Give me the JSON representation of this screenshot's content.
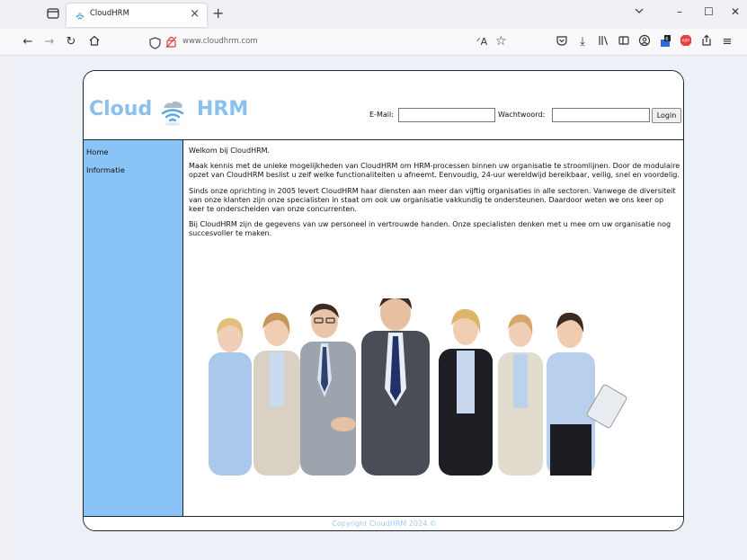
{
  "browser": {
    "tab_title": "CloudHRM",
    "tab_close": "×",
    "new_tab": "+",
    "url": "www.cloudhrm.com",
    "window_controls": {
      "minimize": "–",
      "maximize": "☐",
      "close": "✕"
    },
    "icons": [
      "tab-list-icon",
      "back-icon",
      "forward-icon",
      "reload-icon",
      "home-icon",
      "shield-icon",
      "lock-icon",
      "translate-icon",
      "bookmark-star-icon",
      "pocket-icon",
      "download-icon",
      "library-icon",
      "sidebar-icon",
      "account-icon",
      "extension-icon",
      "adblock-icon",
      "share-icon",
      "menu-icon"
    ]
  },
  "site": {
    "logo": {
      "word1": "Cloud",
      "word2": "HRM"
    },
    "login": {
      "email_label": "E-Mail:",
      "email_value": "",
      "password_label": "Wachtwoord:",
      "password_value": "",
      "button": "Login"
    },
    "menu": [
      {
        "label": "Home"
      },
      {
        "label": "Informatie"
      }
    ],
    "content": {
      "paragraphs": [
        "Welkom bij CloudHRM.",
        "Maak kennis met de unieke mogelijkheden van CloudHRM om HRM-processen binnen uw organisatie te stroomlijnen. Door de modulaire opzet van CloudHRM beslist u zelf welke functionaliteiten u afneemt. Eenvoudig, 24-uur wereldwijd bereikbaar, veilig, snel en voordelig.",
        "Sinds onze oprichting in 2005 levert CloudHRM haar diensten aan meer dan vijftig organisaties in alle sectoren. Vanwege de diversiteit van onze klanten zijn onze specialisten in staat om ook uw organisatie vakkundig te ondersteunen. Daardoor weten we ons keer op keer te onderscheiden van onze concurrenten.",
        "Bij CloudHRM zijn de gegevens van uw personeel in vertrouwde handen. Onze specialisten denken met u mee om uw organisatie nog succesvoller te maken."
      ]
    },
    "footer": "Copyright CloudHRM 2024 ©",
    "colors": {
      "accent": "#8ac3f6",
      "logo": "#89c0ee",
      "border": "#1e2430"
    }
  }
}
